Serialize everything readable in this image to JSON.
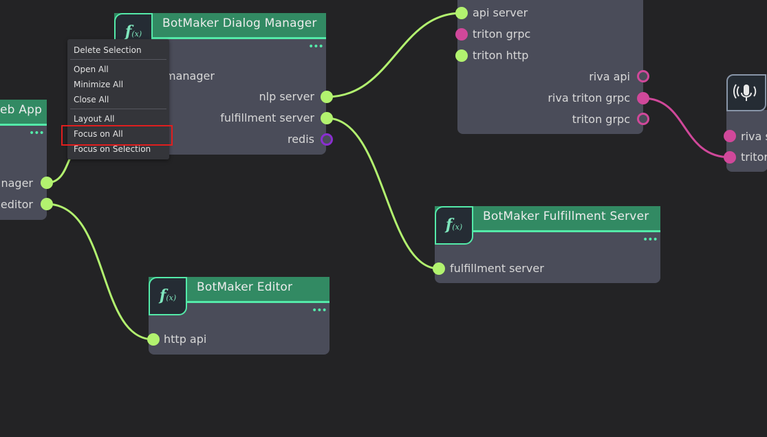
{
  "colors": {
    "background": "#232325",
    "node_body": "#4a4c59",
    "header": "#328a63",
    "accent": "#54eaa9",
    "pin_green": "#b2f26f",
    "pin_magenta": "#d0489a",
    "pin_purple": "#8a2ed0",
    "highlight": "#e01e1e"
  },
  "context_menu": {
    "items": [
      "Delete Selection",
      "Open All",
      "Minimize All",
      "Close All",
      "Layout All",
      "Focus on All",
      "Focus on Selection"
    ]
  },
  "nodes": {
    "dialog_manager": {
      "title": "BotMaker Dialog Manager",
      "icon": "function-icon",
      "ports": [
        "manager",
        "nlp server",
        "fulfillment server",
        "redis"
      ]
    },
    "web_app": {
      "title": "eb App",
      "ports": [
        "anager",
        "editor"
      ]
    },
    "riva_server": {
      "ports": [
        "api server",
        "triton grpc",
        "triton http",
        "riva api",
        "riva triton grpc",
        "triton grpc"
      ]
    },
    "fulfillment_server": {
      "title": "BotMaker Fulfillment Server",
      "icon": "function-icon",
      "ports": [
        "fulfillment server"
      ]
    },
    "editor": {
      "title": "BotMaker Editor",
      "icon": "function-icon",
      "ports": [
        "http api"
      ]
    },
    "speech": {
      "icon": "microphone-icon",
      "ports": [
        "riva s",
        "tritor"
      ]
    }
  },
  "icon_text": {
    "f": "f",
    "x": "(x)",
    "more": "•••"
  }
}
